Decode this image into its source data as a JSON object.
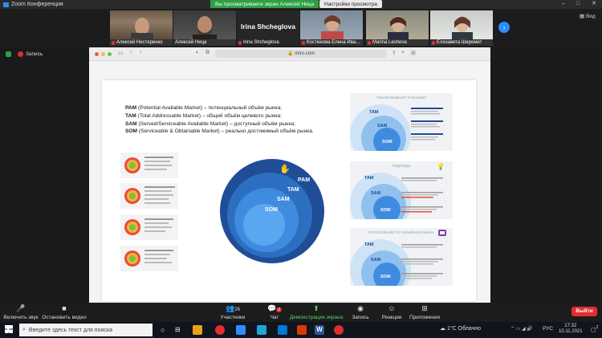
{
  "window": {
    "title": "Zoom Конференция",
    "share_banner": "Вы просматриваете экран Алексей Ница",
    "view_options": "Настройки просмотра",
    "controls": [
      "–",
      "□",
      "✕"
    ]
  },
  "participants": [
    {
      "name": "Алексей Нестеренко"
    },
    {
      "name": "Алексей Ница"
    },
    {
      "name": "Irina Shcheglova",
      "big": "Irina Shcheglova"
    },
    {
      "name": "Костюкова Елена Ива..."
    },
    {
      "name": "Marina Lesheva"
    },
    {
      "name": "Елизавета Шеремет"
    }
  ],
  "view_label": "Вид",
  "record_label": "Запись",
  "browser": {
    "url": "miro.com"
  },
  "slide": {
    "definitions": [
      {
        "abbr": "PAM",
        "text": " (Potential Available Market) – потенциальный объём рынка;"
      },
      {
        "abbr": "TAM",
        "text": " (Total Addressable Market) – общий объём целевого рынка;"
      },
      {
        "abbr": "SAM",
        "text": " (Served/Serviceable Available Market) – доступный объём рынка;"
      },
      {
        "abbr": "SOM",
        "text": " (Serviceable & Obtainable Market) – реально достижимый объём рынка."
      }
    ],
    "circle_labels": [
      "PAM",
      "TAM",
      "SAM",
      "SOM"
    ],
    "right_panels": [
      {
        "heading": "РЫНКИ БЫВАЮТ РАЗНЫМИ",
        "labels": [
          "TAM",
          "SAM",
          "SOM"
        ]
      },
      {
        "heading": "ПОДХОДЫ",
        "labels": [
          "TAM",
          "SAM",
          "SOM"
        ]
      },
      {
        "heading": "ПОПОЛНЕНИЕ ПО ОБЪЁМАМ РЫНКА",
        "labels": [
          "TAM",
          "SAM",
          "SOM"
        ]
      }
    ]
  },
  "toolbar": {
    "mute": "Включить звук",
    "video": "Остановить видео",
    "participants": "Участники",
    "participants_count": "26",
    "chat": "Чат",
    "chat_badge": "2",
    "share": "Демонстрация экрана",
    "record": "Запись",
    "reactions": "Реакции",
    "apps": "Приложения",
    "leave": "Выйти"
  },
  "taskbar": {
    "search_placeholder": "Введите здесь текст для поиска",
    "weather": "1°C Облачно",
    "lang": "РУС",
    "time": "17:32",
    "date": "10.11.2021",
    "notif": "2"
  },
  "colors": {
    "accent": "#2d8cff",
    "share_green": "#2ea043",
    "leave_red": "#e02f2f",
    "circle_outer": "#1f4e96",
    "circle_mid": "#2c6fc1",
    "circle_inner": "#3f8be0",
    "circle_core": "#5aa6f0"
  }
}
